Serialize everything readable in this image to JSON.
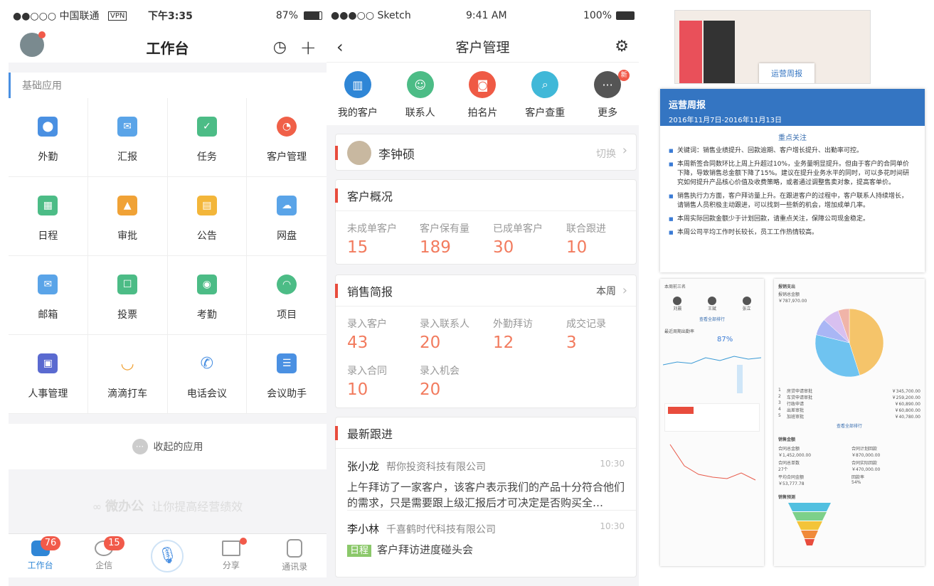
{
  "s1": {
    "status": {
      "carrier": "●●○○○ 中国联通",
      "vpn": "VPN",
      "time": "下午3:35",
      "battery": "87%"
    },
    "title": "工作台",
    "section": "基础应用",
    "apps": [
      {
        "label": "外勤",
        "color": "#4a90e2",
        "icon": "location-icon"
      },
      {
        "label": "汇报",
        "color": "#5aa4e8",
        "icon": "report-icon"
      },
      {
        "label": "任务",
        "color": "#4cbc86",
        "icon": "task-icon"
      },
      {
        "label": "客户管理",
        "color": "#f06048",
        "icon": "pie-icon"
      },
      {
        "label": "日程",
        "color": "#4cbc86",
        "icon": "calendar-icon"
      },
      {
        "label": "审批",
        "color": "#f0a236",
        "icon": "stamp-icon"
      },
      {
        "label": "公告",
        "color": "#f3b63a",
        "icon": "notice-icon"
      },
      {
        "label": "网盘",
        "color": "#5aa4e8",
        "icon": "cloud-icon"
      },
      {
        "label": "邮箱",
        "color": "#5aa4e8",
        "icon": "mail-icon"
      },
      {
        "label": "投票",
        "color": "#4cbc86",
        "icon": "vote-icon"
      },
      {
        "label": "考勤",
        "color": "#4cbc86",
        "icon": "fingerprint-icon"
      },
      {
        "label": "项目",
        "color": "#4cbc86",
        "icon": "gauge-icon"
      },
      {
        "label": "人事管理",
        "color": "#5a6ad0",
        "icon": "id-card-icon"
      },
      {
        "label": "滴滴打车",
        "color": "#f0a236",
        "icon": "didi-icon"
      },
      {
        "label": "电话会议",
        "color": "#4a90e2",
        "icon": "phone-icon"
      },
      {
        "label": "会议助手",
        "color": "#4a90e2",
        "icon": "meeting-icon"
      }
    ],
    "collapsed": "收起的应用",
    "slogan_brand": "微办公",
    "slogan": "让你提高经营绩效",
    "tabs": [
      {
        "label": "工作台",
        "badge": "76"
      },
      {
        "label": "企信",
        "badge": "15"
      },
      {
        "label": "",
        "badge": ""
      },
      {
        "label": "分享",
        "badge": ""
      },
      {
        "label": "通讯录",
        "badge": ""
      }
    ]
  },
  "s2": {
    "status": {
      "carrier": "●●●○○ Sketch",
      "time": "9:41 AM",
      "battery": "100%"
    },
    "title": "客户管理",
    "quick": [
      {
        "label": "我的客户",
        "color": "#2f86d6",
        "icon": "building-icon"
      },
      {
        "label": "联系人",
        "color": "#4cbc86",
        "icon": "user-icon"
      },
      {
        "label": "拍名片",
        "color": "#ef5a45",
        "icon": "camera-icon"
      },
      {
        "label": "客户查重",
        "color": "#40b8d8",
        "icon": "search-icon"
      },
      {
        "label": "更多",
        "color": "#555555",
        "icon": "more-icon",
        "badge": "新"
      }
    ],
    "user": {
      "name": "李钟硕",
      "action": "切换"
    },
    "overview": {
      "title": "客户概况",
      "items": [
        {
          "label": "未成单客户",
          "value": "15"
        },
        {
          "label": "客户保有量",
          "value": "189"
        },
        {
          "label": "已成单客户",
          "value": "30"
        },
        {
          "label": "联合跟进",
          "value": "10"
        }
      ]
    },
    "sales": {
      "title": "销售简报",
      "period": "本周",
      "items": [
        {
          "label": "录入客户",
          "value": "43"
        },
        {
          "label": "录入联系人",
          "value": "20"
        },
        {
          "label": "外勤拜访",
          "value": "12"
        },
        {
          "label": "成交记录",
          "value": "3"
        },
        {
          "label": "录入合同",
          "value": "10"
        },
        {
          "label": "录入机会",
          "value": "20"
        }
      ]
    },
    "followup": {
      "title": "最新跟进",
      "items": [
        {
          "name": "张小龙",
          "company": "帮你投资科技有限公司",
          "time": "10:30",
          "body": "上午拜访了一家客户，该客户表示我们的产品十分符合他们的需求，只是需要跟上级汇报后才可决定是否购买全…"
        },
        {
          "name": "李小林",
          "company": "千喜鹤时代科技有限公司",
          "time": "10:30",
          "tag": "日程",
          "body": "客户拜访进度碰头会"
        }
      ]
    }
  },
  "s3": {
    "thumb_title": "运营周报",
    "report": {
      "title": "运营周报",
      "date": "2016年11月7日-2016年11月13日",
      "focus": "重点关注",
      "points": [
        "关键词：销售业绩提升、回款逾期、客户增长提升、出勤率可控。",
        "本周新签合同数环比上周上升超过10%，业务量明显提升。但由于客户的合同单价下降，导致销售总金额下降了15%。建议在提升业务水平的同时，可以多花时间研究如何提升产品核心价值及收费策略，或者通过调整售卖对象，提高客单价。",
        "销售执行力方面，客户拜访量上升。在跟进客户的过程中，客户联系人持续增长，请销售人员积极主动跟进，可以找到一些新的机会，增加成单几率。",
        "本周实际回款金额少于计划回款，请重点关注，保障公司现金稳定。",
        "本周公司平均工作时长较长，员工工作热情较高。"
      ]
    },
    "expense": {
      "title": "报销支出",
      "total_label": "报销总金额",
      "total": "￥787,970.00",
      "rows": [
        {
          "no": "1",
          "name": "房贷申请审批",
          "amount": "￥345,700.00",
          "color": "#f5c46a"
        },
        {
          "no": "2",
          "name": "车贷申请审批",
          "amount": "￥259,200.00",
          "color": "#6fc3f0"
        },
        {
          "no": "3",
          "name": "行政申请",
          "amount": "￥60,890.00",
          "color": "#a9b6f5"
        },
        {
          "no": "4",
          "name": "出差审批",
          "amount": "￥60,800.00",
          "color": "#d8c0f0"
        },
        {
          "no": "5",
          "name": "加班审批",
          "amount": "￥40,780.00",
          "color": "#f0b4a8"
        }
      ],
      "more": "查看全部排行"
    },
    "sales_amount": {
      "title": "销售金额",
      "items": [
        {
          "label": "合同总金额",
          "value": "￥1,452,000.00"
        },
        {
          "label": "合同计划回款",
          "value": "￥870,000.00"
        },
        {
          "label": "合同总单数",
          "value": "27个"
        },
        {
          "label": "合同实际回款",
          "value": "￥470,000.00"
        },
        {
          "label": "平均合同金额",
          "value": "￥53,777.78"
        },
        {
          "label": "回款率",
          "value": "54%"
        }
      ]
    },
    "forecast": {
      "title": "销售预测"
    },
    "left_panel": {
      "rank_title": "本周前三名",
      "rank_names": [
        "刘晨",
        "王斌",
        "张立"
      ],
      "rate_title": "最近周期出勤率",
      "rate": "87%",
      "more": "查看全部排行"
    }
  },
  "chart_data": {
    "type": "pie",
    "categories": [
      "房贷申请审批",
      "车贷申请审批",
      "行政申请",
      "出差审批",
      "加班审批"
    ],
    "values": [
      345700,
      259200,
      60890,
      60800,
      40780
    ],
    "title": "报销支出",
    "xlabel": "",
    "ylabel": ""
  }
}
